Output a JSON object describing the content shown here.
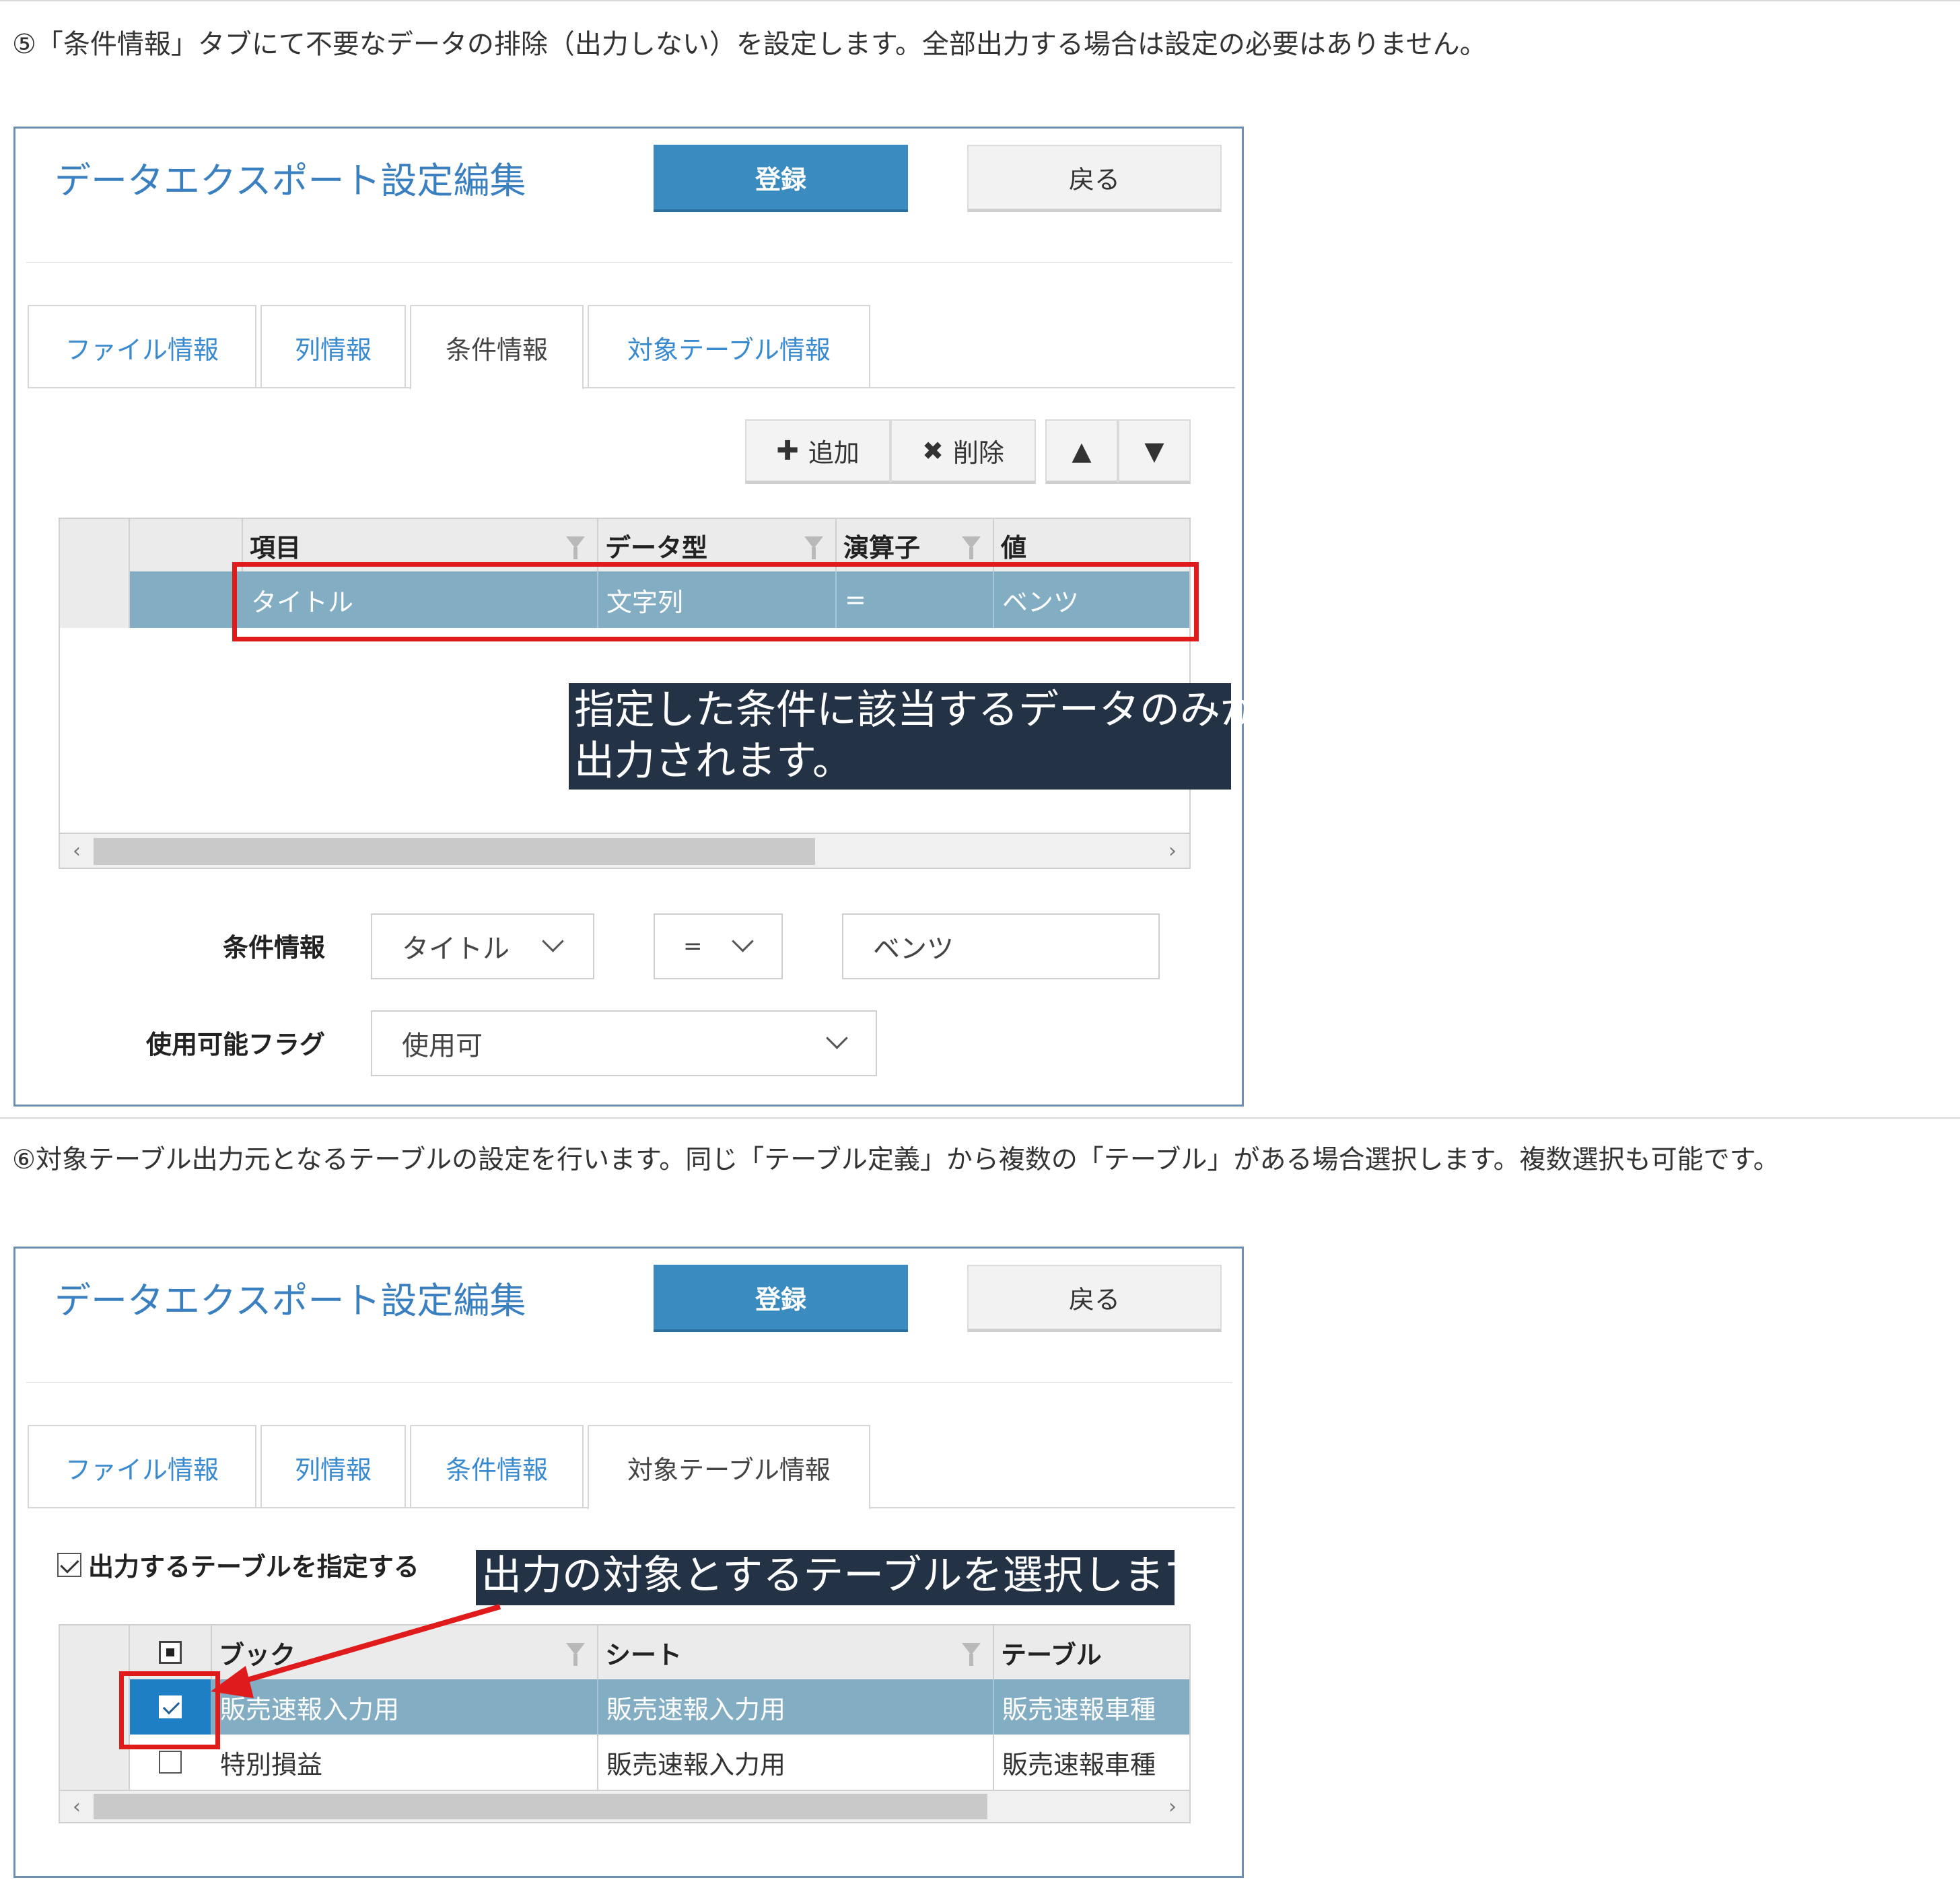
{
  "step5_text": "⑤「条件情報」タブにて不要なデータの排除（出力しない）を設定します。全部出力する場合は設定の必要はありません。",
  "step6_text": "⑥対象テーブル出力元となるテーブルの設定を行います。同じ「テーブル定義」から複数の「テーブル」がある場合選択します。複数選択も可能です。",
  "app": {
    "title": "データエクスポート設定編集",
    "register_label": "登録",
    "back_label": "戻る"
  },
  "tabs": [
    "ファイル情報",
    "列情報",
    "条件情報",
    "対象テーブル情報"
  ],
  "panel1": {
    "active_tab": "条件情報",
    "toolbar": {
      "add_label": "追加",
      "delete_label": "削除",
      "up_glyph": "▲",
      "down_glyph": "▼",
      "add_glyph": "✚",
      "delete_glyph": "✖"
    },
    "grid": {
      "columns": [
        "項目",
        "データ型",
        "演算子",
        "値"
      ],
      "rows": [
        [
          "タイトル",
          "文字列",
          "=",
          "ベンツ"
        ]
      ]
    },
    "callout": [
      "指定した条件に該当するデータのみが",
      "出力されます。"
    ],
    "form": {
      "condition_label": "条件情報",
      "item_value": "タイトル",
      "operator_value": "=",
      "value_value": "ベンツ",
      "flag_label": "使用可能フラグ",
      "flag_value": "使用可"
    }
  },
  "panel2": {
    "active_tab": "対象テーブル情報",
    "specify_checkbox_label": "出力するテーブルを指定する",
    "specify_checked": true,
    "callout": "出力の対象とするテーブルを選択します。",
    "grid": {
      "columns": [
        "ブック",
        "シート",
        "テーブル"
      ],
      "rows": [
        {
          "checked": true,
          "book": "販売速報入力用",
          "sheet": "販売速報入力用",
          "table": "販売速報車種",
          "selected": true
        },
        {
          "checked": false,
          "book": "特別損益",
          "sheet": "販売速報入力用",
          "table": "販売速報車種",
          "selected": false
        }
      ]
    }
  },
  "colors": {
    "accent": "#3a8bc0",
    "selected_row": "#82adc3",
    "highlight_red": "#e01b1b",
    "callout_bg": "#233245",
    "title_blue": "#3a7fbf"
  }
}
